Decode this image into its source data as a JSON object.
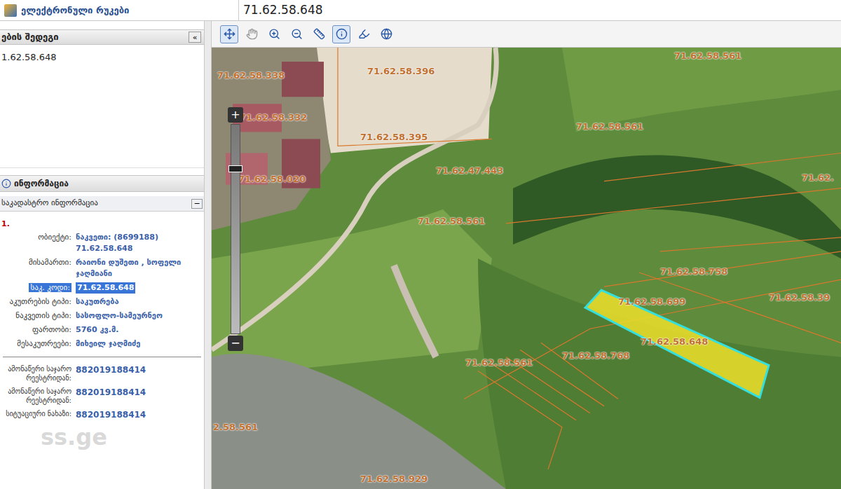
{
  "header": {
    "logo": "ელექტრონული რუკები",
    "search": "71.62.58.648"
  },
  "toolbar": [
    {
      "selected": true,
      "disabled": false
    },
    {
      "selected": false,
      "disabled": true
    },
    {
      "selected": false,
      "disabled": false
    },
    {
      "selected": false,
      "disabled": false
    },
    {
      "selected": false,
      "disabled": false
    },
    {
      "selected": true,
      "disabled": false
    },
    {
      "selected": false,
      "disabled": false
    },
    {
      "selected": false,
      "disabled": false
    }
  ],
  "results": {
    "title": "ების შედეგი",
    "collapse": "«",
    "items": [
      "1.62.58.648"
    ]
  },
  "info": {
    "title": "ინფორმაცია",
    "section": "საკადასტრო ინფორმაცია",
    "toggle": "−",
    "index": "1.",
    "fields": [
      {
        "label": "ობიექტი:",
        "value": "ნაკვეთი: (8699188)",
        "extra": "71.62.58.648",
        "highlighted": false
      },
      {
        "label": "მისამართი:",
        "value": "რაიონი დუშეთი , სოფელი ჯაღმიანი",
        "extra": "",
        "highlighted": false
      },
      {
        "label": "საკ. კოდი:",
        "value": "71.62.58.648",
        "extra": "",
        "highlighted": true
      },
      {
        "label": "აკუთრების ტიპი:",
        "value": "საკუთრება",
        "extra": "",
        "highlighted": false
      },
      {
        "label": "ნაკვეთის ტიპი:",
        "value": "სასოფლო-სამეურნეო",
        "extra": "",
        "highlighted": false
      },
      {
        "label": "ფართობი:",
        "value": "5760 კვ.მ.",
        "extra": "",
        "highlighted": false
      },
      {
        "label": "მესაკუთრეები:",
        "value": "მიხეილ ჯაღმიძე",
        "extra": "",
        "highlighted": false
      }
    ],
    "documents": [
      {
        "label": "ამონაწერი საჯარო რეესტრიდან:",
        "value": "882019188414"
      },
      {
        "label": "ამონაწერი საჯარო რეესტრიდან:",
        "value": "882019188414"
      },
      {
        "label": "სიტუაციური ნახაზი:",
        "value": "882019188414"
      }
    ]
  },
  "zoom": {
    "plus": "+",
    "minus": "−",
    "level": 0.8
  },
  "map": {
    "labels": [
      "71.62.58.338",
      "71.62.58.396",
      "71.62.58.561",
      "71.62.58.332",
      "71.62.58.395",
      "71.62.58.561",
      "71.62.47.443",
      "71.62.58.020",
      "71.62.58.561",
      "71.62.58.758",
      "71.62.58.699",
      "71.62.58.39",
      "71.62.58.648",
      "71.62.58.768",
      "71.62.58.561",
      "2.58.561",
      "71.62.58.929",
      "71.62."
    ]
  },
  "watermark": "ss.ge"
}
